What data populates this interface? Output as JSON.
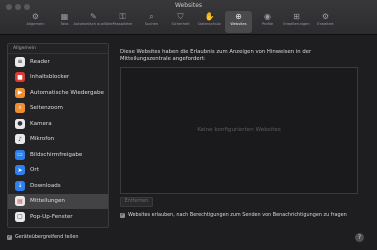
{
  "window": {
    "title": "Websites"
  },
  "toolbar": {
    "items": [
      {
        "label": "Allgemein",
        "icon": "⚙"
      },
      {
        "label": "Tabs",
        "icon": "▦"
      },
      {
        "label": "Automatisch ausfüllen",
        "icon": "✎"
      },
      {
        "label": "Passwörter",
        "icon": "⚿"
      },
      {
        "label": "Suchen",
        "icon": "⌕"
      },
      {
        "label": "Sicherheit",
        "icon": "⛉"
      },
      {
        "label": "Datenschutz",
        "icon": "✋"
      },
      {
        "label": "Websites",
        "icon": "⊕"
      },
      {
        "label": "Profile",
        "icon": "◉"
      },
      {
        "label": "Erweiterungen",
        "icon": "⊞"
      },
      {
        "label": "Erweitert",
        "icon": "⚙"
      }
    ],
    "active_index": 7
  },
  "sidebar": {
    "header": "Allgemein",
    "items": [
      {
        "label": "Reader",
        "icon": "≡",
        "color": "#e9e9eb",
        "fg": "#222"
      },
      {
        "label": "Inhaltsblocker",
        "icon": "■",
        "color": "#d93b30",
        "fg": "#fff"
      },
      {
        "label": "Automatische Wiedergabe",
        "icon": "▶",
        "color": "#ef8e2d",
        "fg": "#fff"
      },
      {
        "label": "Seitenzoom",
        "icon": "⌕",
        "color": "#ef8e2d",
        "fg": "#fff"
      },
      {
        "label": "Kamera",
        "icon": "●",
        "color": "#e9e9eb",
        "fg": "#333"
      },
      {
        "label": "Mikrofon",
        "icon": "♪",
        "color": "#e9e9eb",
        "fg": "#333"
      },
      {
        "label": "Bildschirmfreigabe",
        "icon": "▭",
        "color": "#2f80ed",
        "fg": "#fff"
      },
      {
        "label": "Ort",
        "icon": "➤",
        "color": "#2f80ed",
        "fg": "#fff"
      },
      {
        "label": "Downloads",
        "icon": "↓",
        "color": "#2f80ed",
        "fg": "#fff"
      },
      {
        "label": "Mitteilungen",
        "icon": "▤",
        "color": "#e9e9eb",
        "fg": "#d93b30"
      },
      {
        "label": "Pop-Up-Fenster",
        "icon": "▢",
        "color": "#e9e9eb",
        "fg": "#333"
      }
    ],
    "selected_index": 9
  },
  "main": {
    "description": "Diese Websites haben die Erlaubnis zum Anzeigen von Hinweisen in der Mitteilungszentrale angefordert:",
    "empty_text": "Keine konfigurierten Websites",
    "remove_label": "Entfernen",
    "allow_requests_label": "Websites erlauben, nach Berechtigungen zum Senden von Benachrichtigungen zu fragen",
    "allow_requests_checked": true
  },
  "footer": {
    "share_label": "Geräteübergreifend teilen",
    "share_checked": true,
    "help_label": "?"
  }
}
